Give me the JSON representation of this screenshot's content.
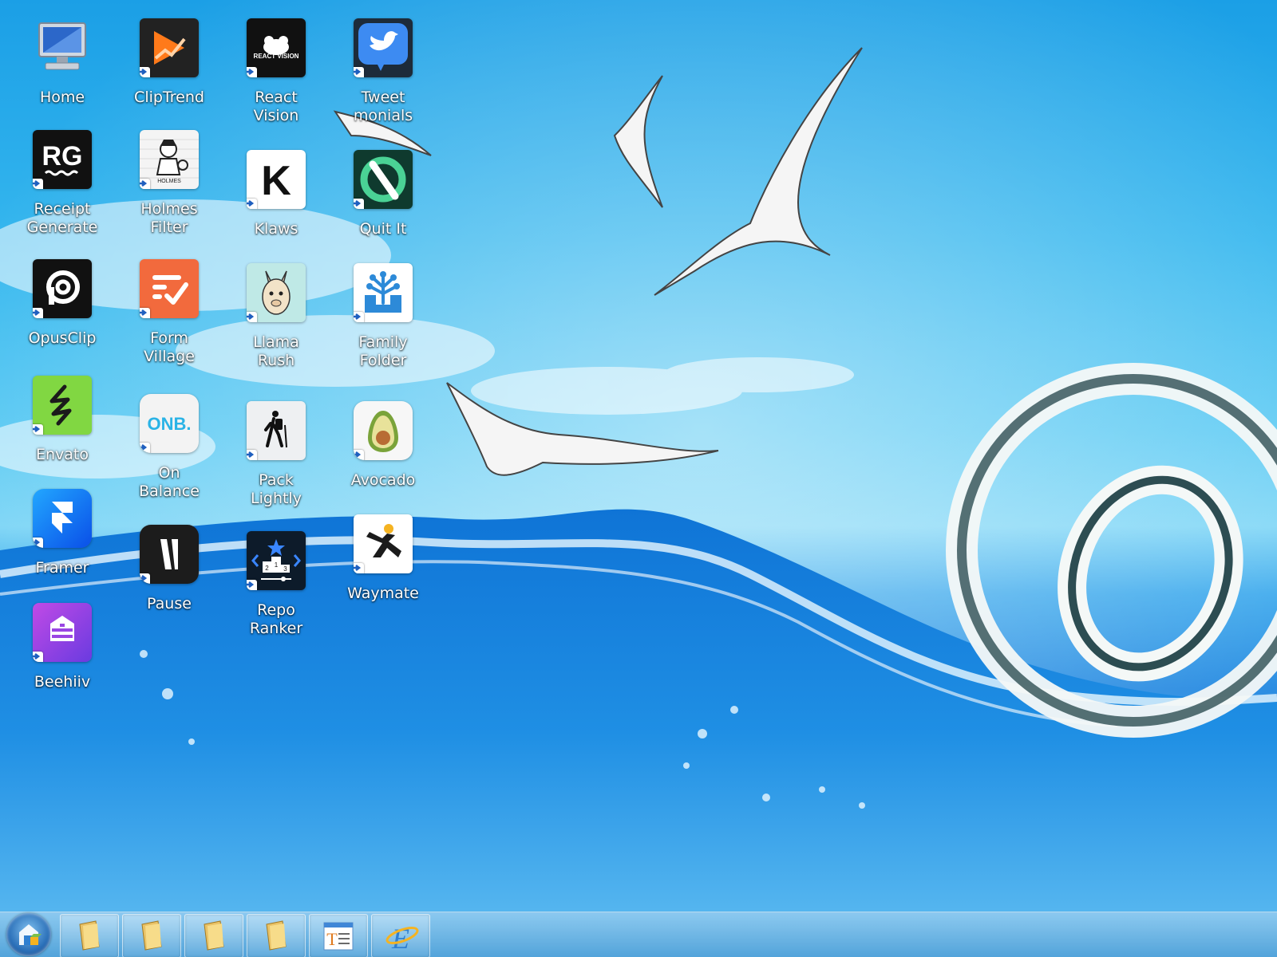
{
  "desktop": {
    "icons": [
      {
        "label": "Home",
        "icon": "computer-monitor-icon",
        "shortcut": false
      },
      {
        "label": "ClipTrend",
        "icon": "cliptrend-app-icon",
        "shortcut": true
      },
      {
        "label": "React\nVision",
        "icon": "react-vision-app-icon",
        "shortcut": true
      },
      {
        "label": "Tweet\nmonials",
        "icon": "tweetmonials-bird-icon",
        "shortcut": true
      },
      {
        "label": "Receipt\nGenerate",
        "icon": "receipt-generator-rg-icon",
        "shortcut": true
      },
      {
        "label": "Holmes\nFilter",
        "icon": "holmes-filter-detective-icon",
        "shortcut": true
      },
      {
        "label": "Klaws",
        "icon": "klaws-k-icon",
        "shortcut": true
      },
      {
        "label": "Quit It",
        "icon": "quit-it-icon",
        "shortcut": true
      },
      {
        "label": "OpusClip",
        "icon": "opusclip-icon",
        "shortcut": true
      },
      {
        "label": "Form\nVillage",
        "icon": "form-village-icon",
        "shortcut": true
      },
      {
        "label": "Llama\nRush",
        "icon": "llama-rush-icon",
        "shortcut": true
      },
      {
        "label": "Family\nFolder",
        "icon": "family-folder-tree-icon",
        "shortcut": true
      },
      {
        "label": "Envato",
        "icon": "envato-icon",
        "shortcut": true
      },
      {
        "label": "On\nBalance",
        "icon": "on-balance-onb-icon",
        "shortcut": true
      },
      {
        "label": "Pack\nLightly",
        "icon": "pack-lightly-hiker-icon",
        "shortcut": true
      },
      {
        "label": "Avocado",
        "icon": "avocado-icon",
        "shortcut": true
      },
      {
        "label": "Framer",
        "icon": "framer-icon",
        "shortcut": true
      },
      {
        "label": "Pause",
        "icon": "pause-icon",
        "shortcut": true
      },
      {
        "label": "Repo\nRanker",
        "icon": "repo-ranker-podium-icon",
        "shortcut": true
      },
      {
        "label": "Waymate",
        "icon": "waymate-icon",
        "shortcut": true
      },
      {
        "label": "Beehiiv",
        "icon": "beehiiv-hive-icon",
        "shortcut": true
      }
    ],
    "icon_texts": {
      "react_vision": "REACT VISION",
      "receipt": "RG",
      "holmes": "HOLMES",
      "klaws": "K",
      "on_balance": "ONB.",
      "podium": [
        "2",
        "1",
        "3"
      ]
    }
  },
  "taskbar": {
    "start_icon": "start-orb-icon",
    "buttons": [
      {
        "icon": "file-explorer-folder-icon"
      },
      {
        "icon": "file-explorer-folder-icon"
      },
      {
        "icon": "file-explorer-folder-icon"
      },
      {
        "icon": "file-explorer-folder-icon"
      },
      {
        "icon": "text-editor-icon",
        "text": "T"
      },
      {
        "icon": "internet-explorer-icon",
        "text": "E"
      }
    ]
  },
  "colors": {
    "sky": "#34b6ee",
    "water": "#1f86e0",
    "taskbar": "#5aa9dd"
  }
}
